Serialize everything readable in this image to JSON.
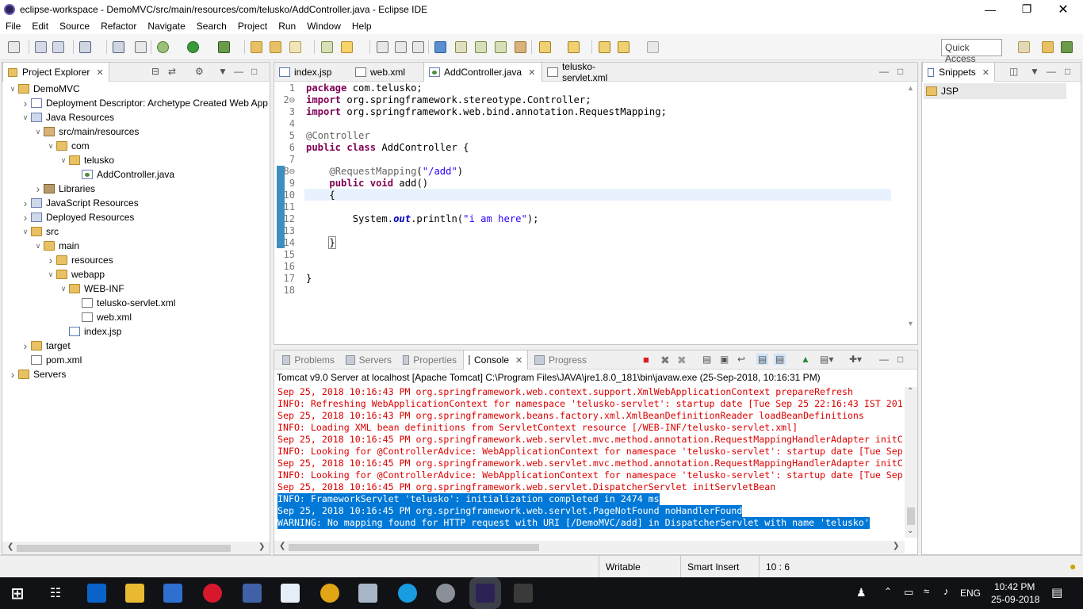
{
  "window": {
    "title": "eclipse-workspace - DemoMVC/src/main/resources/com/telusko/AddController.java - Eclipse IDE"
  },
  "menu": [
    "File",
    "Edit",
    "Source",
    "Refactor",
    "Navigate",
    "Search",
    "Project",
    "Run",
    "Window",
    "Help"
  ],
  "toolbar": {
    "quick_access": "Quick Access"
  },
  "project_explorer": {
    "tab_label": "Project Explorer",
    "tree": [
      {
        "label": "DemoMVC",
        "depth": 0,
        "twisty": "open",
        "icon": "project-icon"
      },
      {
        "label": "Deployment Descriptor: Archetype Created Web App",
        "depth": 1,
        "twisty": "closed",
        "icon": "deployment-descriptor-icon"
      },
      {
        "label": "Java Resources",
        "depth": 1,
        "twisty": "open",
        "icon": "java-resources-icon"
      },
      {
        "label": "src/main/resources",
        "depth": 2,
        "twisty": "open",
        "icon": "source-folder-icon"
      },
      {
        "label": "com",
        "depth": 3,
        "twisty": "open",
        "icon": "folder-icon"
      },
      {
        "label": "telusko",
        "depth": 4,
        "twisty": "open",
        "icon": "folder-icon"
      },
      {
        "label": "AddController.java",
        "depth": 5,
        "twisty": "none",
        "icon": "java-file-icon"
      },
      {
        "label": "Libraries",
        "depth": 2,
        "twisty": "closed",
        "icon": "library-icon"
      },
      {
        "label": "JavaScript Resources",
        "depth": 1,
        "twisty": "closed",
        "icon": "javascript-resources-icon"
      },
      {
        "label": "Deployed Resources",
        "depth": 1,
        "twisty": "closed",
        "icon": "deployed-resources-icon"
      },
      {
        "label": "src",
        "depth": 1,
        "twisty": "open",
        "icon": "folder-icon"
      },
      {
        "label": "main",
        "depth": 2,
        "twisty": "open",
        "icon": "folder-icon"
      },
      {
        "label": "resources",
        "depth": 3,
        "twisty": "closed",
        "icon": "folder-icon"
      },
      {
        "label": "webapp",
        "depth": 3,
        "twisty": "open",
        "icon": "folder-icon"
      },
      {
        "label": "WEB-INF",
        "depth": 4,
        "twisty": "open",
        "icon": "folder-icon"
      },
      {
        "label": "telusko-servlet.xml",
        "depth": 5,
        "twisty": "none",
        "icon": "xml-file-icon"
      },
      {
        "label": "web.xml",
        "depth": 5,
        "twisty": "none",
        "icon": "xml-file-icon"
      },
      {
        "label": "index.jsp",
        "depth": 4,
        "twisty": "none",
        "icon": "jsp-file-icon"
      },
      {
        "label": "target",
        "depth": 1,
        "twisty": "closed",
        "icon": "folder-icon"
      },
      {
        "label": "pom.xml",
        "depth": 1,
        "twisty": "none",
        "icon": "xml-file-icon"
      },
      {
        "label": "Servers",
        "depth": 0,
        "twisty": "closed",
        "icon": "folder-icon"
      }
    ]
  },
  "editor": {
    "tabs": [
      {
        "label": "index.jsp",
        "active": false
      },
      {
        "label": "web.xml",
        "active": false
      },
      {
        "label": "AddController.java",
        "active": true
      },
      {
        "label": "telusko-servlet.xml",
        "active": false
      }
    ],
    "lines": [
      {
        "no": "1",
        "html": "<span class='kw'>package</span> com.telusko;"
      },
      {
        "no": "2⊖",
        "html": "<span class='kw'>import</span> org.springframework.stereotype.Controller;"
      },
      {
        "no": "3",
        "html": "<span class='kw'>import</span> org.springframework.web.bind.annotation.RequestMapping;"
      },
      {
        "no": "4",
        "html": ""
      },
      {
        "no": "5",
        "html": "<span class='anno'>@Controller</span>"
      },
      {
        "no": "6",
        "html": "<span class='kw'>public</span> <span class='kw'>class</span> AddController {"
      },
      {
        "no": "7",
        "html": ""
      },
      {
        "no": "8⊖",
        "html": "    <span class='anno'>@RequestMapping</span>(<span class='str'>\"/add\"</span>)"
      },
      {
        "no": "9",
        "html": "    <span class='kw'>public</span> <span class='kw'>void</span> add()"
      },
      {
        "no": "10",
        "html": "    {"
      },
      {
        "no": "11",
        "html": ""
      },
      {
        "no": "12",
        "html": "        System.<span class='field'>out</span>.println(<span class='str'>\"i am here\"</span>);"
      },
      {
        "no": "13",
        "html": ""
      },
      {
        "no": "14",
        "html": "    <span style='outline:1px solid #888;color:#000'>}</span>"
      },
      {
        "no": "15",
        "html": ""
      },
      {
        "no": "16",
        "html": ""
      },
      {
        "no": "17",
        "html": "}"
      },
      {
        "no": "18",
        "html": ""
      }
    ]
  },
  "snippets": {
    "tab_label": "Snippets",
    "item": "JSP"
  },
  "console": {
    "tabs": [
      "Problems",
      "Servers",
      "Properties",
      "Console",
      "Progress"
    ],
    "active_tab": "Console",
    "header": "Tomcat v9.0 Server at localhost [Apache Tomcat] C:\\Program Files\\JAVA\\jre1.8.0_181\\bin\\javaw.exe (25-Sep-2018, 10:16:31 PM)",
    "lines": [
      {
        "text": "Sep 25, 2018 10:16:43 PM org.springframework.web.context.support.XmlWebApplicationContext prepareRefresh",
        "selected": false
      },
      {
        "text": "INFO: Refreshing WebApplicationContext for namespace 'telusko-servlet': startup date [Tue Sep 25 22:16:43 IST 201",
        "selected": false
      },
      {
        "text": "Sep 25, 2018 10:16:43 PM org.springframework.beans.factory.xml.XmlBeanDefinitionReader loadBeanDefinitions",
        "selected": false
      },
      {
        "text": "INFO: Loading XML bean definitions from ServletContext resource [/WEB-INF/telusko-servlet.xml]",
        "selected": false
      },
      {
        "text": "Sep 25, 2018 10:16:45 PM org.springframework.web.servlet.mvc.method.annotation.RequestMappingHandlerAdapter initC",
        "selected": false
      },
      {
        "text": "INFO: Looking for @ControllerAdvice: WebApplicationContext for namespace 'telusko-servlet': startup date [Tue Sep",
        "selected": false
      },
      {
        "text": "Sep 25, 2018 10:16:45 PM org.springframework.web.servlet.mvc.method.annotation.RequestMappingHandlerAdapter initC",
        "selected": false
      },
      {
        "text": "INFO: Looking for @ControllerAdvice: WebApplicationContext for namespace 'telusko-servlet': startup date [Tue Sep",
        "selected": false
      },
      {
        "text": "Sep 25, 2018 10:16:45 PM org.springframework.web.servlet.DispatcherServlet initServletBean",
        "selected": false
      },
      {
        "text": "INFO: FrameworkServlet 'telusko': initialization completed in 2474 ms",
        "selected": true
      },
      {
        "text": "Sep 25, 2018 10:16:45 PM org.springframework.web.servlet.PageNotFound noHandlerFound",
        "selected": true
      },
      {
        "text": "WARNING: No mapping found for HTTP request with URI [/DemoMVC/add] in DispatcherServlet with name 'telusko'",
        "selected": true
      }
    ]
  },
  "status": {
    "writable": "Writable",
    "insert_mode": "Smart Insert",
    "position": "10 : 6"
  },
  "taskbar": {
    "language": "ENG",
    "time": "10:42 PM",
    "date": "25-09-2018",
    "apps": [
      {
        "name": "start-icon",
        "color": "#101216"
      },
      {
        "name": "task-view-icon",
        "color": "#101216"
      },
      {
        "name": "edge-icon",
        "color": "#0a63c9"
      },
      {
        "name": "file-explorer-icon",
        "color": "#e8b931"
      },
      {
        "name": "store-icon",
        "color": "#2f6fcf"
      },
      {
        "name": "opera-icon",
        "color": "#d6182d"
      },
      {
        "name": "network-app-icon",
        "color": "#4060a8"
      },
      {
        "name": "vlc-v2-icon",
        "color": "#e6eef8"
      },
      {
        "name": "chrome-icon",
        "color": "#e1a616"
      },
      {
        "name": "keyboard-app-icon",
        "color": "#a9b6c8"
      },
      {
        "name": "skype-icon",
        "color": "#1a9ce0"
      },
      {
        "name": "disk-app-icon",
        "color": "#8b8f99"
      },
      {
        "name": "eclipse-icon",
        "color": "#2c2255"
      },
      {
        "name": "camera-app-icon",
        "color": "#3a3a3a"
      }
    ]
  }
}
